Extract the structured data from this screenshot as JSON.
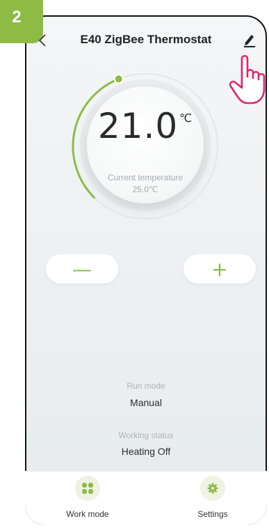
{
  "step_badge": "2",
  "header": {
    "title": "E40 ZigBee Thermostat"
  },
  "thermostat": {
    "setpoint": "21.0",
    "unit": "℃",
    "current_label": "Current temperature",
    "current_value": "25.0℃",
    "ring_progress": 0.42
  },
  "controls": {
    "minus_label": "—",
    "plus_label": "+"
  },
  "info": {
    "run_mode_label": "Run mode",
    "run_mode_value": "Manual",
    "working_status_label": "Working status",
    "working_status_value": "Heating Off"
  },
  "bottom_nav": {
    "work_mode_label": "Work mode",
    "settings_label": "Settings"
  },
  "colors": {
    "accent": "#8dbb44",
    "hand": "#e0246b"
  },
  "icons": {
    "back": "chevron-left-icon",
    "edit": "pencil-icon",
    "pointer": "hand-pointer-icon",
    "work_mode": "four-leaf-grid-icon",
    "settings": "gear-icon"
  }
}
